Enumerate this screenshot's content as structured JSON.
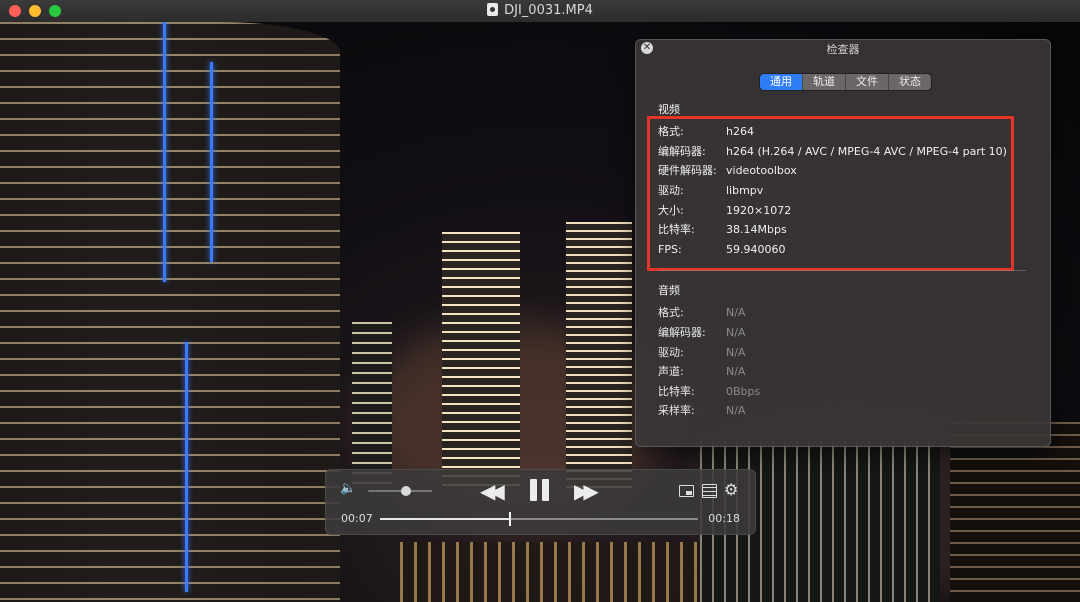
{
  "window": {
    "title": "DJI_0031.MP4"
  },
  "inspector": {
    "title": "检查器",
    "close_icon": "close-icon",
    "tabs": [
      {
        "label": "通用",
        "active": true
      },
      {
        "label": "轨道",
        "active": false
      },
      {
        "label": "文件",
        "active": false
      },
      {
        "label": "状态",
        "active": false
      }
    ],
    "video": {
      "heading": "视频",
      "rows": [
        {
          "label": "格式:",
          "value": "h264"
        },
        {
          "label": "编解码器:",
          "value": "h264 (H.264 / AVC / MPEG-4 AVC / MPEG-4 part 10)"
        },
        {
          "label": "硬件解码器:",
          "value": "videotoolbox"
        },
        {
          "label": "驱动:",
          "value": "libmpv"
        },
        {
          "label": "大小:",
          "value": "1920×1072"
        },
        {
          "label": "比特率:",
          "value": "38.14Mbps"
        },
        {
          "label": "FPS:",
          "value": "59.940060"
        }
      ]
    },
    "audio": {
      "heading": "音频",
      "rows": [
        {
          "label": "格式:",
          "value": "N/A"
        },
        {
          "label": "编解码器:",
          "value": "N/A"
        },
        {
          "label": "驱动:",
          "value": "N/A"
        },
        {
          "label": "声道:",
          "value": "N/A"
        },
        {
          "label": "比特率:",
          "value": "0Bbps"
        },
        {
          "label": "采样率:",
          "value": "N/A"
        }
      ]
    },
    "highlight_color": "#e5342a",
    "accent_color": "#2f7df6"
  },
  "controls": {
    "current_time": "00:07",
    "duration": "00:18",
    "progress_fraction": 0.41,
    "volume_fraction": 0.6,
    "icons": [
      "volume-icon",
      "rewind-icon",
      "pause-icon",
      "fast-forward-icon",
      "pip-icon",
      "playlist-icon",
      "settings-gear-icon"
    ]
  }
}
